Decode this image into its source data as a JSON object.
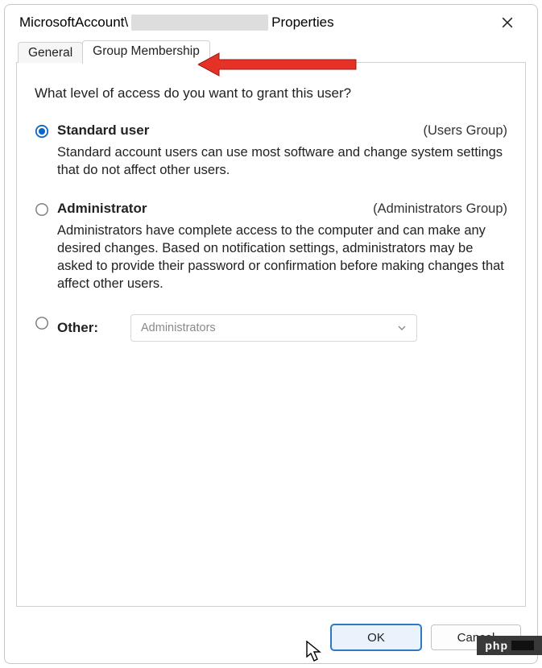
{
  "title": {
    "prefix": "MicrosoftAccount\\",
    "suffix": "Properties"
  },
  "tabs": {
    "general": "General",
    "group_membership": "Group Membership"
  },
  "main": {
    "question": "What level of access do you want to grant this user?",
    "options": {
      "standard": {
        "label": "Standard user",
        "aside": "(Users Group)",
        "desc": "Standard account users can use most software and change system settings that do not affect other users."
      },
      "admin": {
        "label": "Administrator",
        "aside": "(Administrators Group)",
        "desc": "Administrators have complete access to the computer and can make any desired changes. Based on notification settings, administrators may be asked to provide their password or confirmation before making changes that affect other users."
      },
      "other": {
        "label": "Other:",
        "dropdown_value": "Administrators"
      }
    }
  },
  "buttons": {
    "ok": "OK",
    "cancel": "Cancel"
  },
  "badge": "php"
}
